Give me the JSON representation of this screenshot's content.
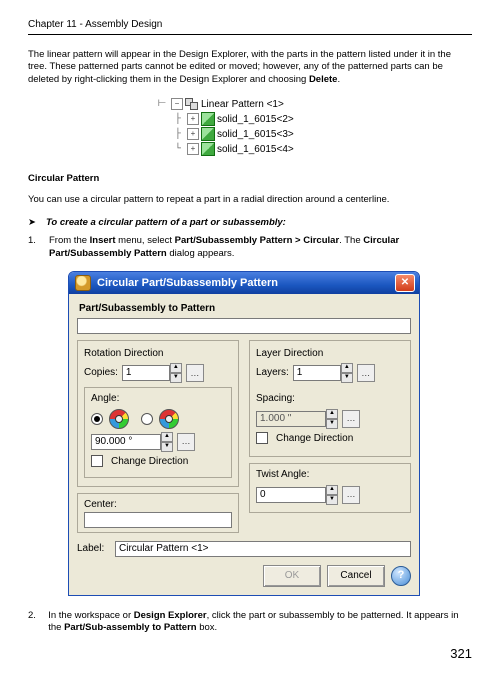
{
  "chapter": "Chapter 11 - Assembly Design",
  "intro": {
    "p1a": "The linear pattern will appear in the Design Explorer, with the parts in the pattern listed under it in the tree. These patterned parts cannot be edited or moved; however, any of the patterned parts can be deleted by right-clicking them in the Design Explorer and choosing ",
    "p1b": "Delete",
    "p1c": "."
  },
  "tree": {
    "root": "Linear Pattern <1>",
    "children": [
      "solid_1_6015<2>",
      "solid_1_6015<3>",
      "solid_1_6015<4>"
    ]
  },
  "section_title": "Circular Pattern",
  "section_intro": "You can use a circular pattern to repeat a part in a radial direction around a centerline.",
  "task_title": "To create a circular pattern of a part or subassembly:",
  "step1": {
    "a": "From the ",
    "b": "Insert",
    "c": " menu, select ",
    "d": "Part/Subassembly Pattern > Circular",
    "e": ". The ",
    "f": "Circular Part/Subassembly Pattern",
    "g": " dialog appears."
  },
  "dialog": {
    "title": "Circular Part/Subassembly Pattern",
    "group_top": "Part/Subassembly to Pattern",
    "top_value": "",
    "left": {
      "legend": "Rotation Direction",
      "copies_label": "Copies:",
      "copies": "1",
      "angle_legend": "Angle:",
      "angle": "90.000 °",
      "change_dir": "Change Direction"
    },
    "right": {
      "legend": "Layer Direction",
      "layers_label": "Layers:",
      "layers": "1",
      "spacing_label": "Spacing:",
      "spacing": "1.000 \"",
      "change_dir": "Change Direction"
    },
    "center_label": "Center:",
    "center_value": "",
    "twist_label": "Twist Angle:",
    "twist_value": "0",
    "label_label": "Label:",
    "label_value": "Circular Pattern <1>",
    "ok": "OK",
    "cancel": "Cancel"
  },
  "step2": {
    "a": "In the workspace or ",
    "b": "Design Explorer",
    "c": ", click the part or subassembly to be patterned.  It appears in the ",
    "d": "Part/Sub-assembly to Pattern",
    "e": " box."
  },
  "page": "321"
}
